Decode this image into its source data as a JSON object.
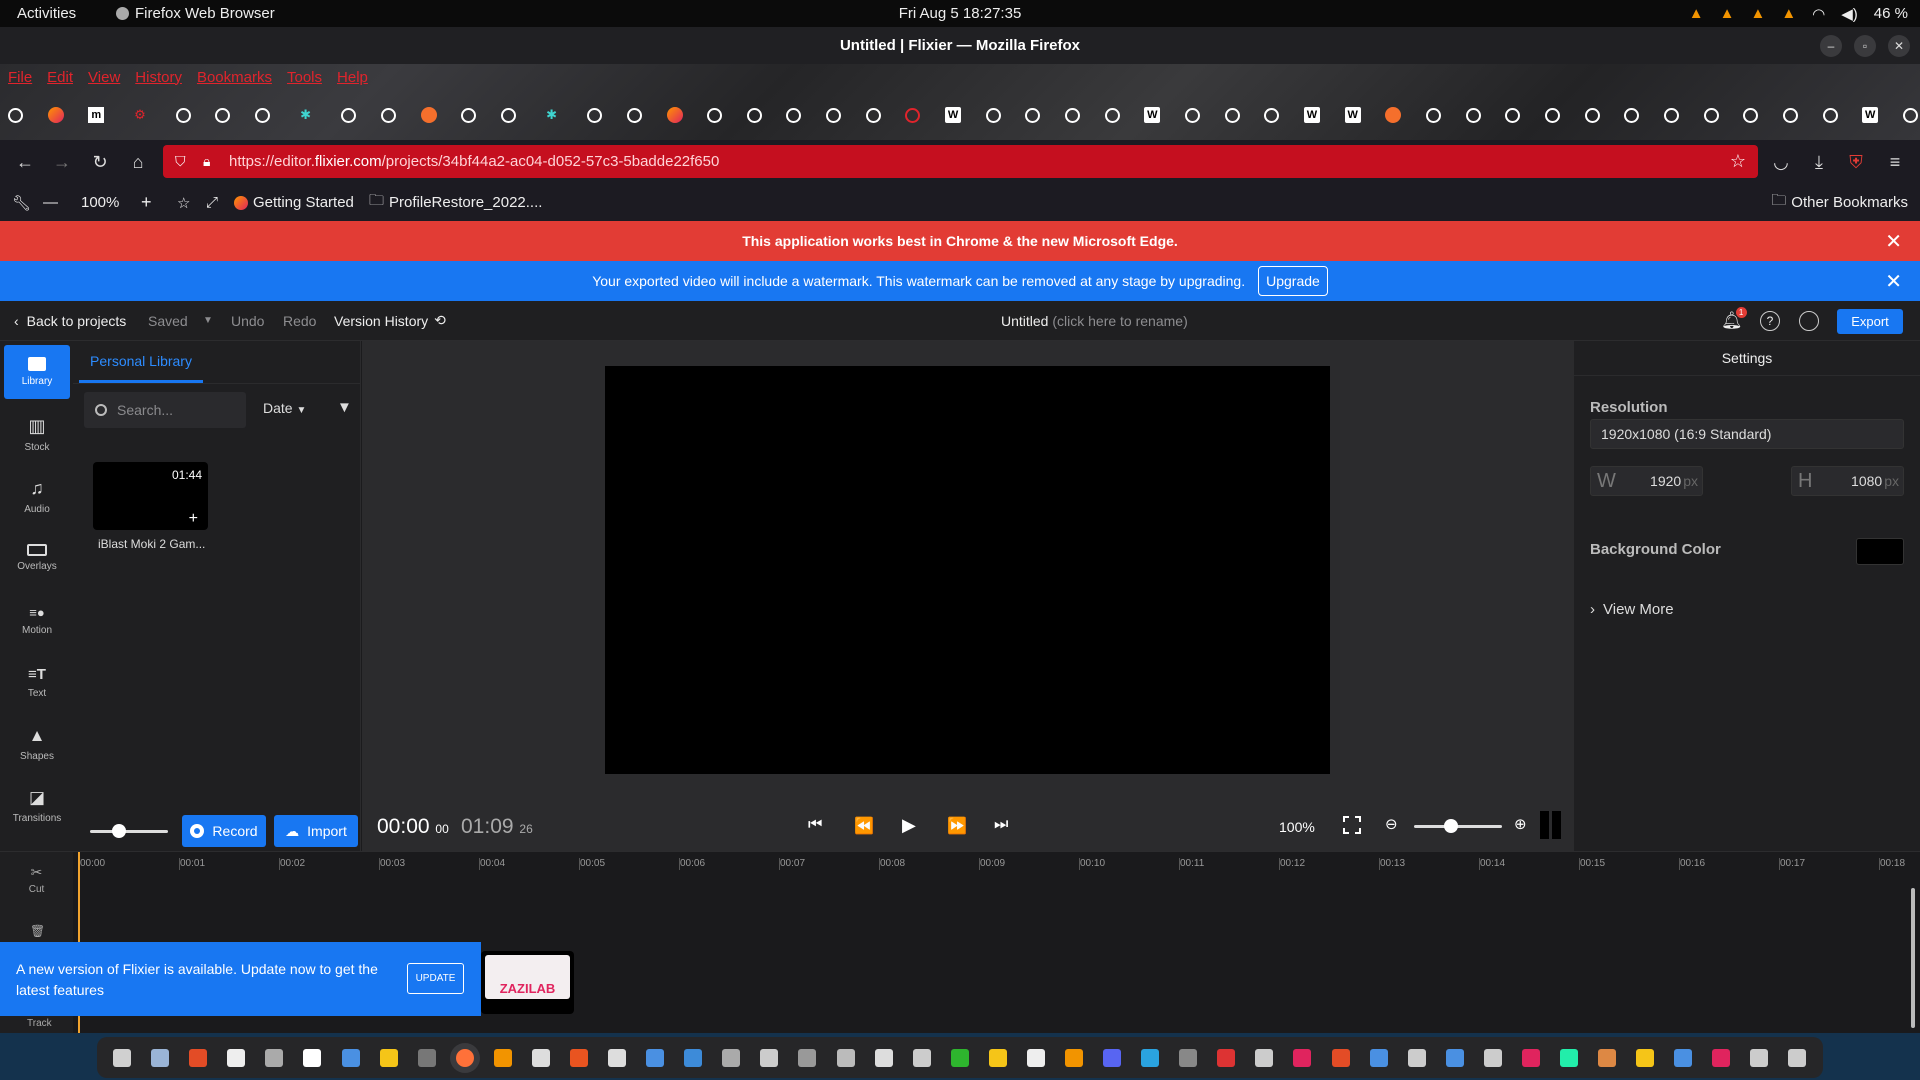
{
  "system_bar": {
    "activities": "Activities",
    "app_name": "Firefox Web Browser",
    "clock": "Fri Aug 5  18:27:35",
    "battery": "46 %"
  },
  "window": {
    "title": "Untitled | Flixier — Mozilla Firefox"
  },
  "menu": {
    "items": [
      "File",
      "Edit",
      "View",
      "History",
      "Bookmarks",
      "Tools",
      "Help"
    ]
  },
  "navigation": {
    "url_prefix": "https://editor.",
    "url_domain": "flixier.com",
    "url_path": "/projects/34bf44a2-ac04-d052-57c3-5badde22f650"
  },
  "bookmarks_toolbar": {
    "zoom": "100%",
    "items": [
      "Getting Started",
      "ProfileRestore_2022...."
    ],
    "other": "Other Bookmarks"
  },
  "banners": {
    "browser_warning": "This application works best in Chrome & the new Microsoft Edge.",
    "watermark_notice": "Your exported video will include a watermark. This watermark can be removed at any stage by upgrading.",
    "upgrade_label": "Upgrade"
  },
  "editor_header": {
    "back": "Back to projects",
    "saved": "Saved",
    "undo": "Undo",
    "redo": "Redo",
    "version_history": "Version History",
    "project_name": "Untitled",
    "rename_hint": "(click here to rename)",
    "notification_count": "1",
    "export": "Export"
  },
  "rail": {
    "items": [
      "Library",
      "Stock",
      "Audio",
      "Overlays",
      "Motion",
      "Text",
      "Shapes",
      "Transitions"
    ]
  },
  "library": {
    "tab": "Personal Library",
    "search_placeholder": "Search...",
    "sort": "Date",
    "media": [
      {
        "name": "iBlast Moki 2 Gam...",
        "duration": "01:44"
      }
    ],
    "record": "Record",
    "import": "Import"
  },
  "player": {
    "current_time": "00:00",
    "current_frames": "00",
    "total_time": "01:09",
    "total_frames": "26",
    "zoom": "100%"
  },
  "settings": {
    "title": "Settings",
    "resolution_label": "Resolution",
    "resolution_value": "1920x1080 (16:9 Standard)",
    "width_letter": "W",
    "width": "1920",
    "height_letter": "H",
    "height": "1080",
    "unit": "px",
    "bg_label": "Background Color",
    "bg_color": "#000000",
    "view_more": "View More"
  },
  "timeline": {
    "ticks": [
      "00:00",
      "00:01",
      "00:02",
      "00:03",
      "00:04",
      "00:05",
      "00:06",
      "00:07",
      "00:08",
      "00:09",
      "00:10",
      "00:11",
      "00:12",
      "00:13",
      "00:14",
      "00:15",
      "00:16",
      "00:17",
      "00:18"
    ],
    "cut": "Cut",
    "track": "Track"
  },
  "update_notice": {
    "text": "A new version of Flixier is available. Update now to get the latest features",
    "button": "UPDATE",
    "thumb_text": "ZAZILAB"
  },
  "colors": {
    "accent": "#1877f2",
    "warning_red": "#e23c35",
    "url_bar_red": "#c50f1f",
    "playhead": "#f2a42e"
  }
}
